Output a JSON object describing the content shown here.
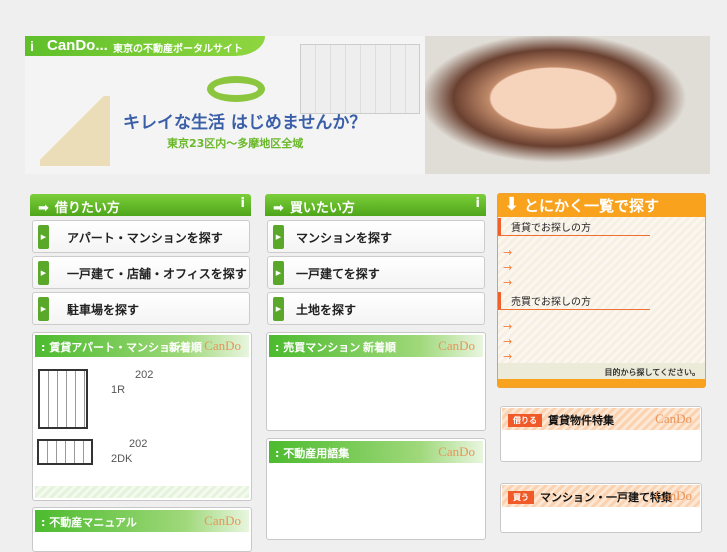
{
  "banner": {
    "logo": "CanDo...",
    "tagline": "東京の不動産ポータルサイト",
    "slogan": "キレイな生活 はじめませんか？",
    "area": "東京23区内〜多摩地区全域"
  },
  "rent": {
    "title": "借りたい方",
    "buttons": [
      "アパート・マンションを探す",
      "一戸建て・店舗・オフィスを探す",
      "駐車場を探す"
    ]
  },
  "buy": {
    "title": "買いたい方",
    "buttons": [
      "マンションを探す",
      "一戸建てを探す",
      "土地を探す"
    ]
  },
  "rent_listings": {
    "title": "賃貸アパート・マンション",
    "sort": "新着順",
    "brand": "CanDo",
    "items": [
      {
        "room": "202",
        "layout": "1R"
      },
      {
        "room": "202",
        "layout": "2DK"
      }
    ]
  },
  "sale_listings": {
    "title": "売買マンション",
    "sort": "新着順",
    "brand": "CanDo"
  },
  "glossary": {
    "title": "不動産用語集",
    "brand": "CanDo"
  },
  "manual": {
    "title": "不動産マニュアル",
    "brand": "CanDo"
  },
  "list_search": {
    "title": "とにかく一覧で探す",
    "rent_section": "賃貸でお探しの方",
    "sale_section": "売買でお探しの方",
    "arrow": "→",
    "footer": "目的から探してください。"
  },
  "features": [
    {
      "badge": "借りる",
      "title": "賃貸物件特集",
      "brand": "CanDo"
    },
    {
      "badge": "買う",
      "title": "マンション・一戸建て特集",
      "brand": "CanDo"
    }
  ]
}
